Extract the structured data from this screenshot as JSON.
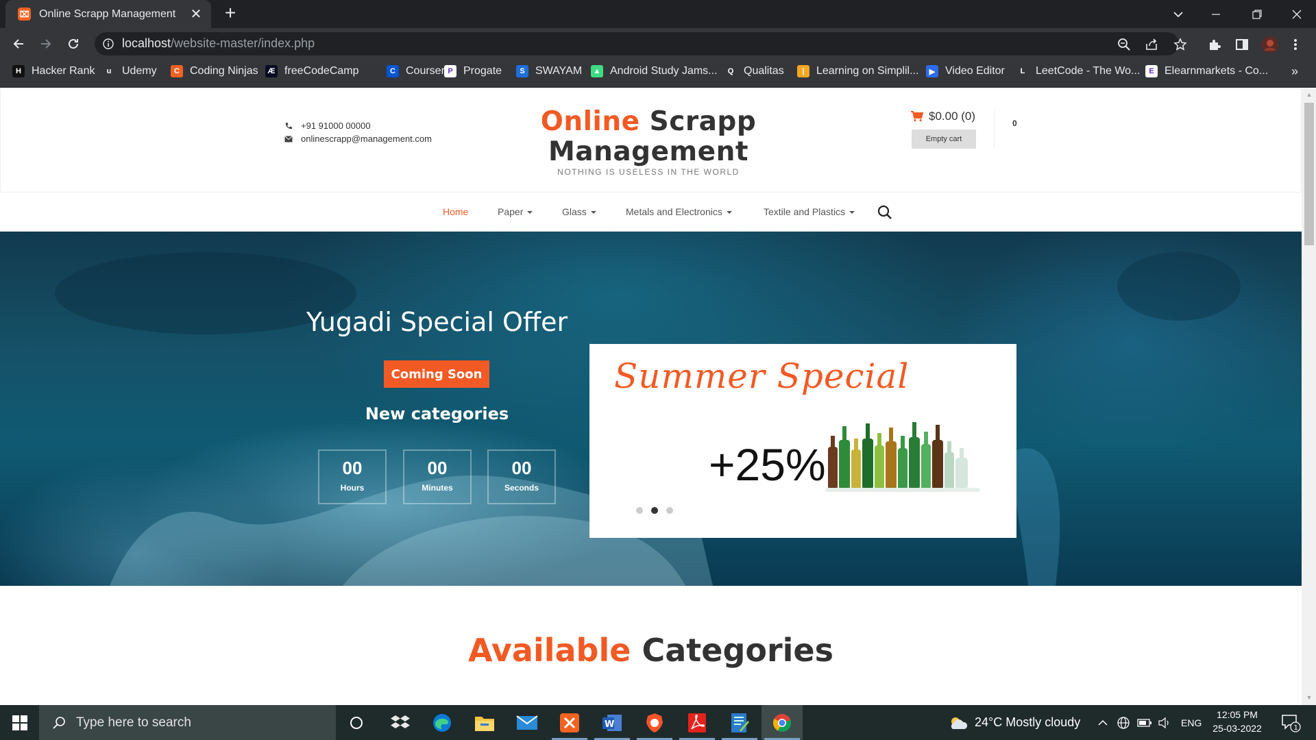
{
  "browser": {
    "tab_title": "Online Scrapp Management",
    "favicon_letter": "⌧",
    "close_symbol": "✕",
    "newtab_symbol": "+",
    "url_host": "localhost",
    "url_path": "/website-master/index.php"
  },
  "bookmarks": [
    {
      "label": "Hacker Rank",
      "icon": "hackerrank-icon",
      "color": "#111111",
      "glyph": "H"
    },
    {
      "label": "Udemy",
      "icon": "udemy-icon",
      "color": "#35363a",
      "glyph": "u"
    },
    {
      "label": "Coding Ninjas",
      "icon": "codingninjas-icon",
      "color": "#f26322",
      "glyph": "C"
    },
    {
      "label": "freeCodeCamp",
      "icon": "freecodecamp-icon",
      "color": "#0a0a23",
      "glyph": "Æ"
    },
    {
      "label": "Coursera",
      "icon": "coursera-icon",
      "color": "#0056d2",
      "glyph": "C"
    },
    {
      "label": "Progate",
      "icon": "progate-icon",
      "color": "#ffffff",
      "glyph": "P"
    },
    {
      "label": "SWAYAM",
      "icon": "swayam-icon",
      "color": "#1e6fd9",
      "glyph": "S"
    },
    {
      "label": "Android Study Jams...",
      "icon": "android-icon",
      "color": "#3ddc84",
      "glyph": "▲"
    },
    {
      "label": "Qualitas",
      "icon": "qualitas-icon",
      "color": "#35363a",
      "glyph": "Q"
    },
    {
      "label": "Learning on Simplil...",
      "icon": "simplilearn-icon",
      "color": "#f5a623",
      "glyph": "|"
    },
    {
      "label": "Video Editor",
      "icon": "video-editor-icon",
      "color": "#2e6bea",
      "glyph": "▶"
    },
    {
      "label": "LeetCode - The Wo...",
      "icon": "leetcode-icon",
      "color": "#35363a",
      "glyph": "L"
    },
    {
      "label": "Elearnmarkets - Co...",
      "icon": "elearnmarkets-icon",
      "color": "#ffffff",
      "glyph": "E"
    }
  ],
  "bookmarks_more": "»",
  "header": {
    "phone": "+91 91000 00000",
    "email": "onlinescrapp@management.com",
    "logo_accent": "Online",
    "logo_rest": " Scrapp",
    "logo_line2": "Management",
    "tagline": "NOTHING IS USELESS IN THE WORLD",
    "cart_total": "$0.00 (0)",
    "empty_cart": "Empty cart",
    "wishlist_count": "0"
  },
  "nav": {
    "items": [
      {
        "label": "Home",
        "active": true
      },
      {
        "label": "Paper",
        "dropdown": true
      },
      {
        "label": "Glass",
        "dropdown": true
      },
      {
        "label": "Metals and Electronics",
        "dropdown": true
      },
      {
        "label": "Textile and Plastics",
        "dropdown": true
      }
    ]
  },
  "hero": {
    "title": "Yugadi Special Offer",
    "button": "Coming Soon",
    "subtitle": "New categories",
    "countdown": [
      {
        "value": "00",
        "label": "Hours"
      },
      {
        "value": "00",
        "label": "Minutes"
      },
      {
        "value": "00",
        "label": "Seconds"
      }
    ],
    "promo_title": "Summer Special",
    "promo_discount": "+25%",
    "slide_active": 2,
    "slide_count": 3
  },
  "section": {
    "title_accent": "Available",
    "title_rest": " Categories"
  },
  "taskbar": {
    "search_placeholder": "Type here to search",
    "weather": "24°C  Mostly cloudy",
    "language": "ENG",
    "time": "12:05 PM",
    "date": "25-03-2022",
    "notification_count": "1"
  },
  "colors": {
    "accent": "#f15a24",
    "chrome_dark": "#202124",
    "chrome_mid": "#35363a"
  }
}
